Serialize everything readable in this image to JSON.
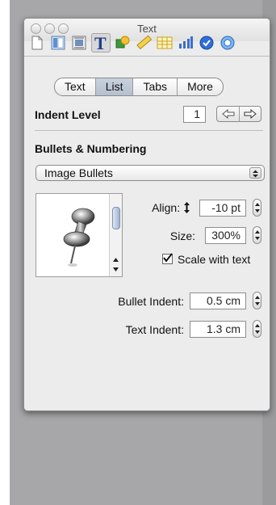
{
  "window": {
    "title": "Text"
  },
  "toolbar": {
    "icons": [
      "document-icon",
      "layout-icon",
      "wrap-icon",
      "text-icon",
      "graphic-icon",
      "metrics-icon",
      "table-icon",
      "chart-icon",
      "link-icon",
      "quicktime-icon"
    ]
  },
  "tabs": [
    {
      "label": "Text",
      "active": false
    },
    {
      "label": "List",
      "active": true
    },
    {
      "label": "Tabs",
      "active": false
    },
    {
      "label": "More",
      "active": false
    }
  ],
  "indent": {
    "label": "Indent Level",
    "value": "1"
  },
  "bullets": {
    "section_label": "Bullets & Numbering",
    "style_selected": "Image Bullets",
    "align_label": "Align:",
    "align_value": "-10 pt",
    "size_label": "Size:",
    "size_value": "300%",
    "scale_label": "Scale with text",
    "scale_checked": true
  },
  "indents": {
    "bullet_label": "Bullet Indent:",
    "bullet_value": "0.5 cm",
    "text_label": "Text Indent:",
    "text_value": "1.3 cm"
  }
}
